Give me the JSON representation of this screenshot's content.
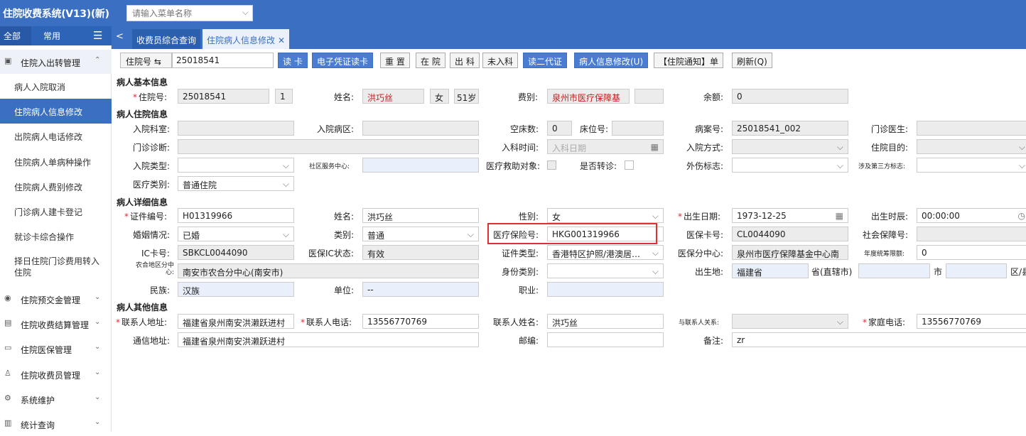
{
  "app": {
    "title": "住院收费系统(V13)(新)",
    "menu_search_placeholder": "请输入菜单名称"
  },
  "side_tabs": {
    "all": "全部",
    "common": "常用"
  },
  "sidebar": {
    "group_open": "住院入出转管理",
    "items": [
      "病人入院取消",
      "住院病人信息修改",
      "出院病人电话修改",
      "住院病人单病种操作",
      "住院病人费别修改",
      "门诊病人建卡登记",
      "就诊卡综合操作",
      "择日住院门诊费用转入住院"
    ],
    "groups": [
      "住院预交金管理",
      "住院收费结算管理",
      "住院医保管理",
      "住院收费员管理",
      "系统维护",
      "统计查询"
    ]
  },
  "tabs": [
    {
      "label": "收费员综合查询"
    },
    {
      "label": "住院病人信息修改"
    }
  ],
  "toolbar": {
    "admission_label": "住院号 ⇆",
    "admission_value": "25018541",
    "buttons": [
      "读 卡",
      "电子凭证读卡",
      "重 置",
      "在 院",
      "出 科",
      "未入科",
      "读二代证",
      "病人信息修改(U)",
      "【住院通知】单",
      "刷新(Q)"
    ]
  },
  "sections": {
    "basic": "病人基本信息",
    "hosp": "病人住院信息",
    "detail": "病人详细信息",
    "other": "病人其他信息"
  },
  "basic": {
    "admission_no_label": "住院号:",
    "admission_no": "25018541",
    "admission_count": "1",
    "name_label": "姓名:",
    "name": "洪巧丝",
    "sex": "女",
    "age": "51岁",
    "fee_type_label": "费别:",
    "fee_type": "泉州市医疗保障基",
    "balance_label": "余额:",
    "balance": "0"
  },
  "hosp": {
    "dept_label": "入院科室:",
    "ward_label": "入院病区:",
    "empty_beds_label": "空床数:",
    "empty_beds": "0",
    "bed_no_label": "床位号:",
    "record_no_label": "病案号:",
    "record_no": "25018541_002",
    "outpatient_doctor_label": "门诊医生:",
    "outpatient_diag_label": "门诊诊断:",
    "admit_time_label": "入科时间:",
    "admit_time_placeholder": "入科日期",
    "admit_method_label": "入院方式:",
    "purpose_label": "住院目的:",
    "admit_type_label": "入院类型:",
    "community_label": "社区服务中心:",
    "aid_label": "医疗救助对象:",
    "transfer_label": "是否转诊:",
    "injury_label": "外伤标志:",
    "third_party_label": "涉及第三方标志:",
    "med_category_label": "医疗类别:",
    "med_category": "普通住院"
  },
  "detail": {
    "id_no_label": "证件编号:",
    "id_no": "H01319966",
    "name_label": "姓名:",
    "name": "洪巧丝",
    "sex_label": "性别:",
    "sex": "女",
    "birth_date_label": "出生日期:",
    "birth_date": "1973-12-25",
    "birth_time_label": "出生时辰:",
    "birth_time": "00:00:00",
    "marital_label": "婚姻情况:",
    "marital": "已婚",
    "category_label": "类别:",
    "category": "普通",
    "ins_no_label": "医疗保险号:",
    "ins_no": "HKG001319966",
    "ins_card_label": "医保卡号:",
    "ins_card": "CL0044090",
    "social_label": "社会保障号:",
    "ic_label": "IC卡号:",
    "ic": "SBKCL0044090",
    "ic_status_label": "医保IC状态:",
    "ic_status": "有效",
    "id_type_label": "证件类型:",
    "id_type": "香港特区护照/港澳居…",
    "ins_center_label": "医保分中心:",
    "ins_center": "泉州市医疗保障基金中心南",
    "annual_label": "年度统筹限额:",
    "annual": "0",
    "rural_label": "农合地区分中心:",
    "rural": "南安市农合分中心(南安市)",
    "identity_label": "身份类别:",
    "birthplace_label": "出生地:",
    "birthplace_prov": "福建省",
    "prov_unit": "省(直辖市)",
    "city_unit": "市",
    "district_unit": "区/县",
    "ethnic_label": "民族:",
    "ethnic": "汉族",
    "employer_label": "单位:",
    "employer": "--",
    "occupation_label": "职业:"
  },
  "other": {
    "contact_addr_label": "联系人地址:",
    "contact_addr": "福建省泉州南安洪濑跃进村",
    "contact_phone_label": "联系人电话:",
    "contact_phone": "13556770769",
    "contact_name_label": "联系人姓名:",
    "contact_name": "洪巧丝",
    "relation_label": "与联系人关系:",
    "home_phone_label": "家庭电话:",
    "home_phone": "13556770769",
    "mail_addr_label": "通信地址:",
    "mail_addr": "福建省泉州南安洪濑跃进村",
    "postcode_label": "邮编:",
    "remark_label": "备注:",
    "remark": "zr"
  },
  "colors": {
    "topbar": "#3a6fc2",
    "highlight": "#e03030",
    "readonly": "#ececec",
    "blue_field": "#e9f0fb",
    "required": "#e23"
  }
}
